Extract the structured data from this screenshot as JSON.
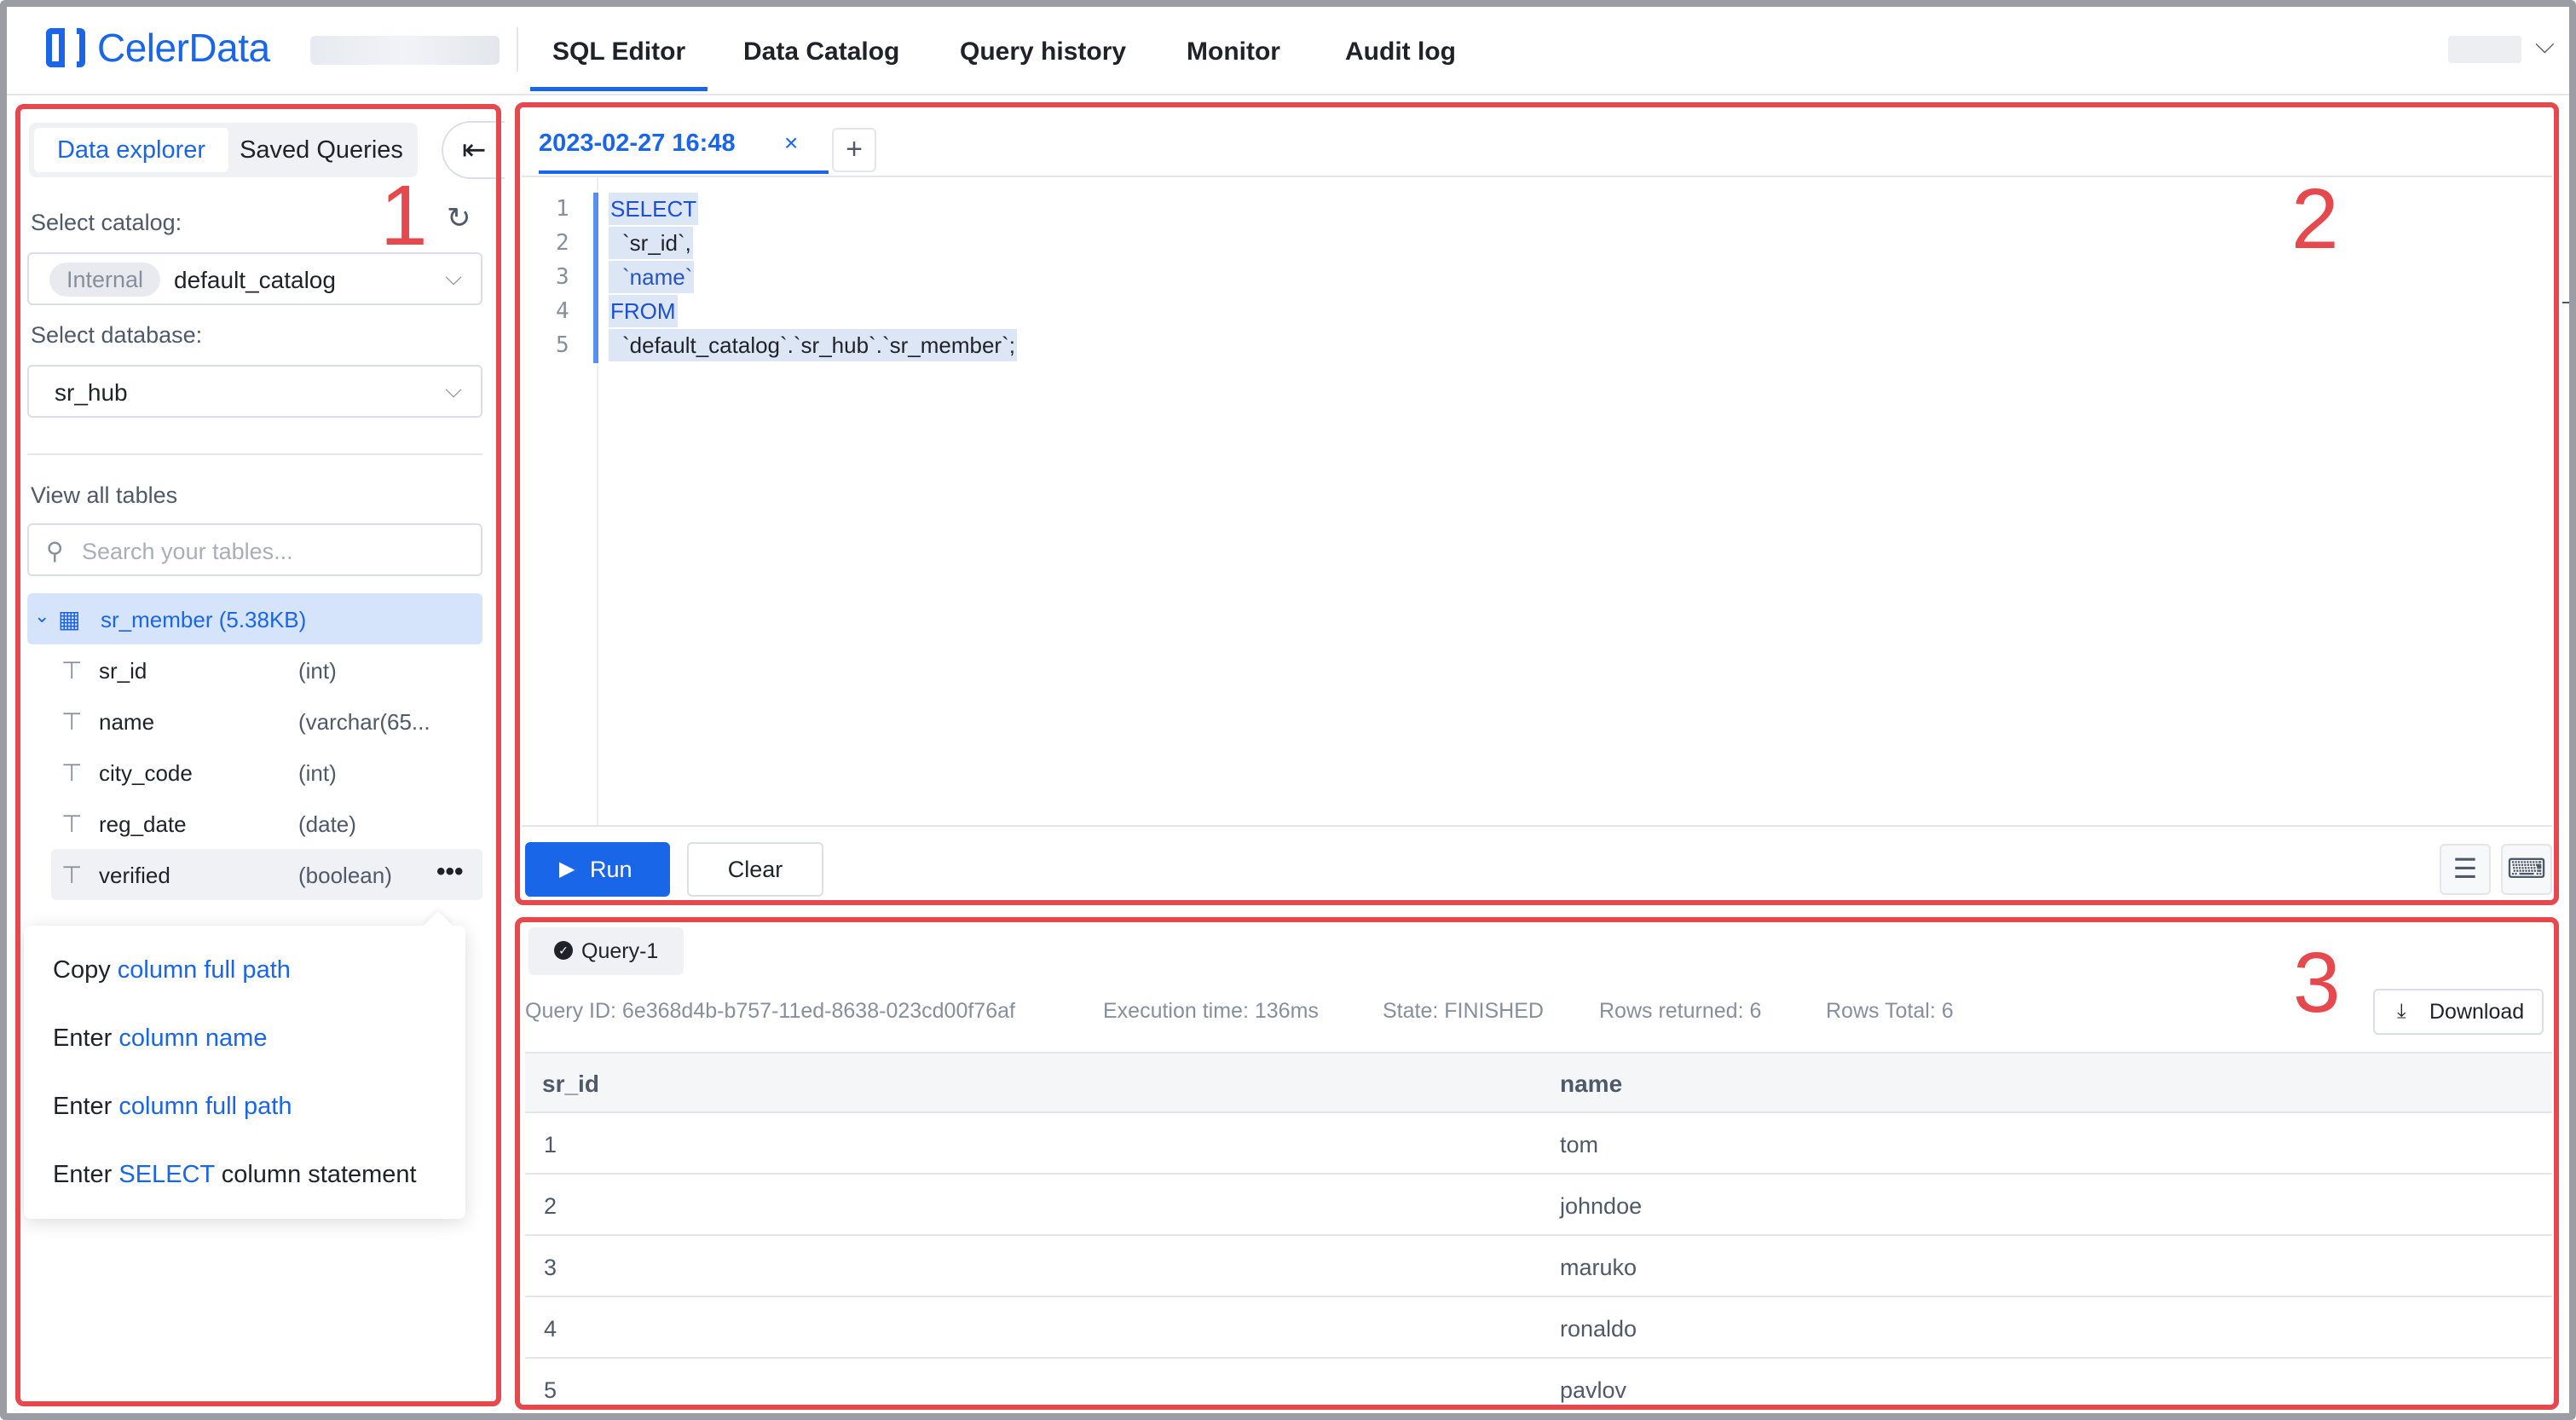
{
  "app": {
    "logo_text": "CelerData",
    "nav": [
      "SQL Editor",
      "Data Catalog",
      "Query history",
      "Monitor",
      "Audit log"
    ],
    "user_chevron": "⌵"
  },
  "annotations": [
    "1",
    "2",
    "3"
  ],
  "explorer": {
    "tab_active": "Data explorer",
    "tab_saved": "Saved Queries",
    "collapse_icon": "⇤",
    "select_catalog_label": "Select catalog:",
    "catalog_tag": "Internal",
    "catalog_value": "default_catalog",
    "select_database_label": "Select database:",
    "database_value": "sr_hub",
    "view_all_tables": "View all tables",
    "search_placeholder": "Search your tables...",
    "table": {
      "name": "sr_member (5.38KB)"
    },
    "columns": [
      {
        "name": "sr_id",
        "type": "(int)"
      },
      {
        "name": "name",
        "type": "(varchar(65..."
      },
      {
        "name": "city_code",
        "type": "(int)"
      },
      {
        "name": "reg_date",
        "type": "(date)"
      },
      {
        "name": "verified",
        "type": "(boolean)"
      }
    ],
    "more_icon": "•••",
    "menu": [
      {
        "prefix": "Copy ",
        "highlight": "column full path",
        "suffix": ""
      },
      {
        "prefix": "Enter ",
        "highlight": "column name",
        "suffix": ""
      },
      {
        "prefix": "Enter ",
        "highlight": "column full path",
        "suffix": ""
      },
      {
        "prefix": "Enter ",
        "highlight": "SELECT",
        "suffix": " column statement"
      }
    ]
  },
  "editor": {
    "tab_title": "2023-02-27 16:48",
    "tab_close": "×",
    "add_tab": "+",
    "line_numbers": [
      "1",
      "2",
      "3",
      "4",
      "5"
    ],
    "code": {
      "l1": "SELECT",
      "l2": "`sr_id`,",
      "l3": "`name`",
      "l4": "FROM",
      "l5": "`default_catalog`.`sr_hub`.`sr_member`;"
    },
    "run_label": "Run",
    "clear_label": "Clear"
  },
  "results": {
    "query_tab": "Query-1",
    "query_id": "Query ID: 6e368d4b-b757-11ed-8638-023cd00f76af",
    "execution_time": "Execution time: 136ms",
    "state": "State: FINISHED",
    "rows_returned": "Rows returned: 6",
    "rows_total": "Rows Total: 6",
    "download_label": "Download",
    "columns": [
      "sr_id",
      "name"
    ],
    "rows": [
      [
        "1",
        "tom"
      ],
      [
        "2",
        "johndoe"
      ],
      [
        "3",
        "maruko"
      ],
      [
        "4",
        "ronaldo"
      ],
      [
        "5",
        "pavlov"
      ]
    ]
  }
}
